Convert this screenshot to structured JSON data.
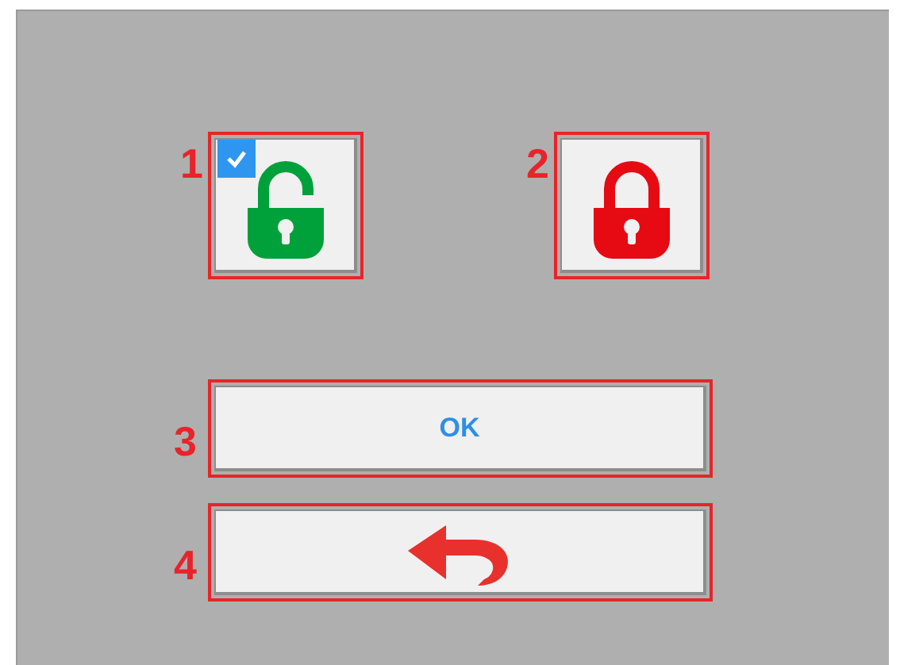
{
  "items": [
    {
      "marker": "1",
      "kind": "lock_toggle",
      "locked": false,
      "checked": true
    },
    {
      "marker": "2",
      "kind": "lock_toggle",
      "locked": true,
      "checked": false
    },
    {
      "marker": "3",
      "kind": "text_button",
      "label": "OK"
    },
    {
      "marker": "4",
      "kind": "back_button"
    }
  ]
}
